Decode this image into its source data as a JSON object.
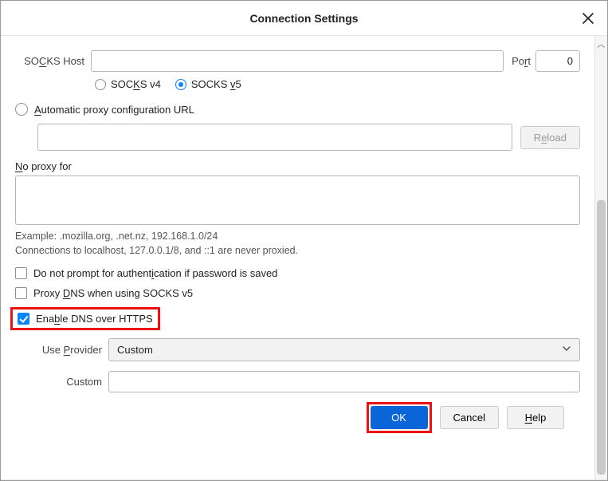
{
  "dialog": {
    "title": "Connection Settings"
  },
  "socks": {
    "host_label_pre": "SO",
    "host_label_key": "C",
    "host_label_post": "KS Host",
    "value": "",
    "port_label_pre": "Po",
    "port_label_key": "r",
    "port_label_post": "t",
    "port_value": "0",
    "v4_label_pre": "SOC",
    "v4_label_key": "K",
    "v4_label_post": "S v4",
    "v5_label_pre": "SOCKS ",
    "v5_label_key": "v",
    "v5_label_post": "5",
    "selected_version": "v5"
  },
  "autopac": {
    "label_key": "A",
    "label_post": "utomatic proxy configuration URL",
    "url_value": "",
    "reload_label_pre": "R",
    "reload_label_key": "e",
    "reload_label_post": "load"
  },
  "noproxy": {
    "label_key": "N",
    "label_post": "o proxy for",
    "value": "",
    "example": "Example: .mozilla.org, .net.nz, 192.168.1.0/24",
    "note": "Connections to localhost, 127.0.0.1/8, and ::1 are never proxied."
  },
  "options": {
    "no_prompt_pre": "Do not prompt for authent",
    "no_prompt_key": "i",
    "no_prompt_post": "cation if password is saved",
    "proxy_dns_pre": "Proxy ",
    "proxy_dns_key": "D",
    "proxy_dns_post": "NS when using SOCKS v5",
    "enable_doh_pre": "Ena",
    "enable_doh_key": "b",
    "enable_doh_post": "le DNS over HTTPS"
  },
  "provider": {
    "label_pre": "Use ",
    "label_key": "P",
    "label_post": "rovider",
    "selected": "Custom",
    "custom_label": "Custom",
    "custom_value": ""
  },
  "buttons": {
    "ok": "OK",
    "cancel": "Cancel",
    "help_key": "H",
    "help_post": "elp"
  }
}
